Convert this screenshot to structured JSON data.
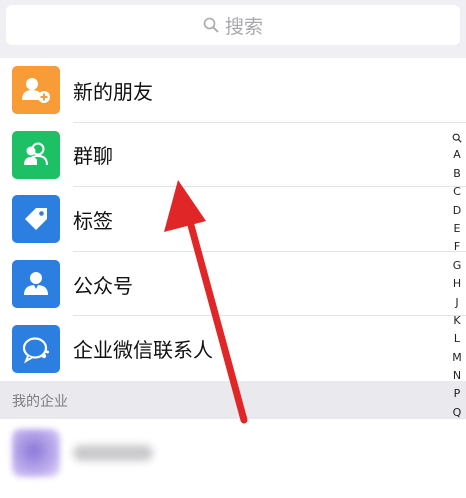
{
  "search": {
    "placeholder": "搜索",
    "icon": "search-icon"
  },
  "contacts": {
    "items": [
      {
        "label": "新的朋友",
        "icon": "add-friend-icon",
        "color": "#f79c37"
      },
      {
        "label": "群聊",
        "icon": "group-chat-icon",
        "color": "#1ec065"
      },
      {
        "label": "标签",
        "icon": "tag-icon",
        "color": "#2c7fe1"
      },
      {
        "label": "公众号",
        "icon": "official-account-icon",
        "color": "#2c7fe1"
      },
      {
        "label": "企业微信联系人",
        "icon": "wecom-contact-icon",
        "color": "#2c7fe1"
      }
    ]
  },
  "section": {
    "title": "我的企业"
  },
  "index": {
    "letters": [
      "A",
      "B",
      "C",
      "D",
      "E",
      "F",
      "G",
      "H",
      "J",
      "K",
      "L",
      "M",
      "N",
      "P",
      "Q"
    ]
  },
  "annotation": {
    "arrow_color": "#e02626"
  }
}
